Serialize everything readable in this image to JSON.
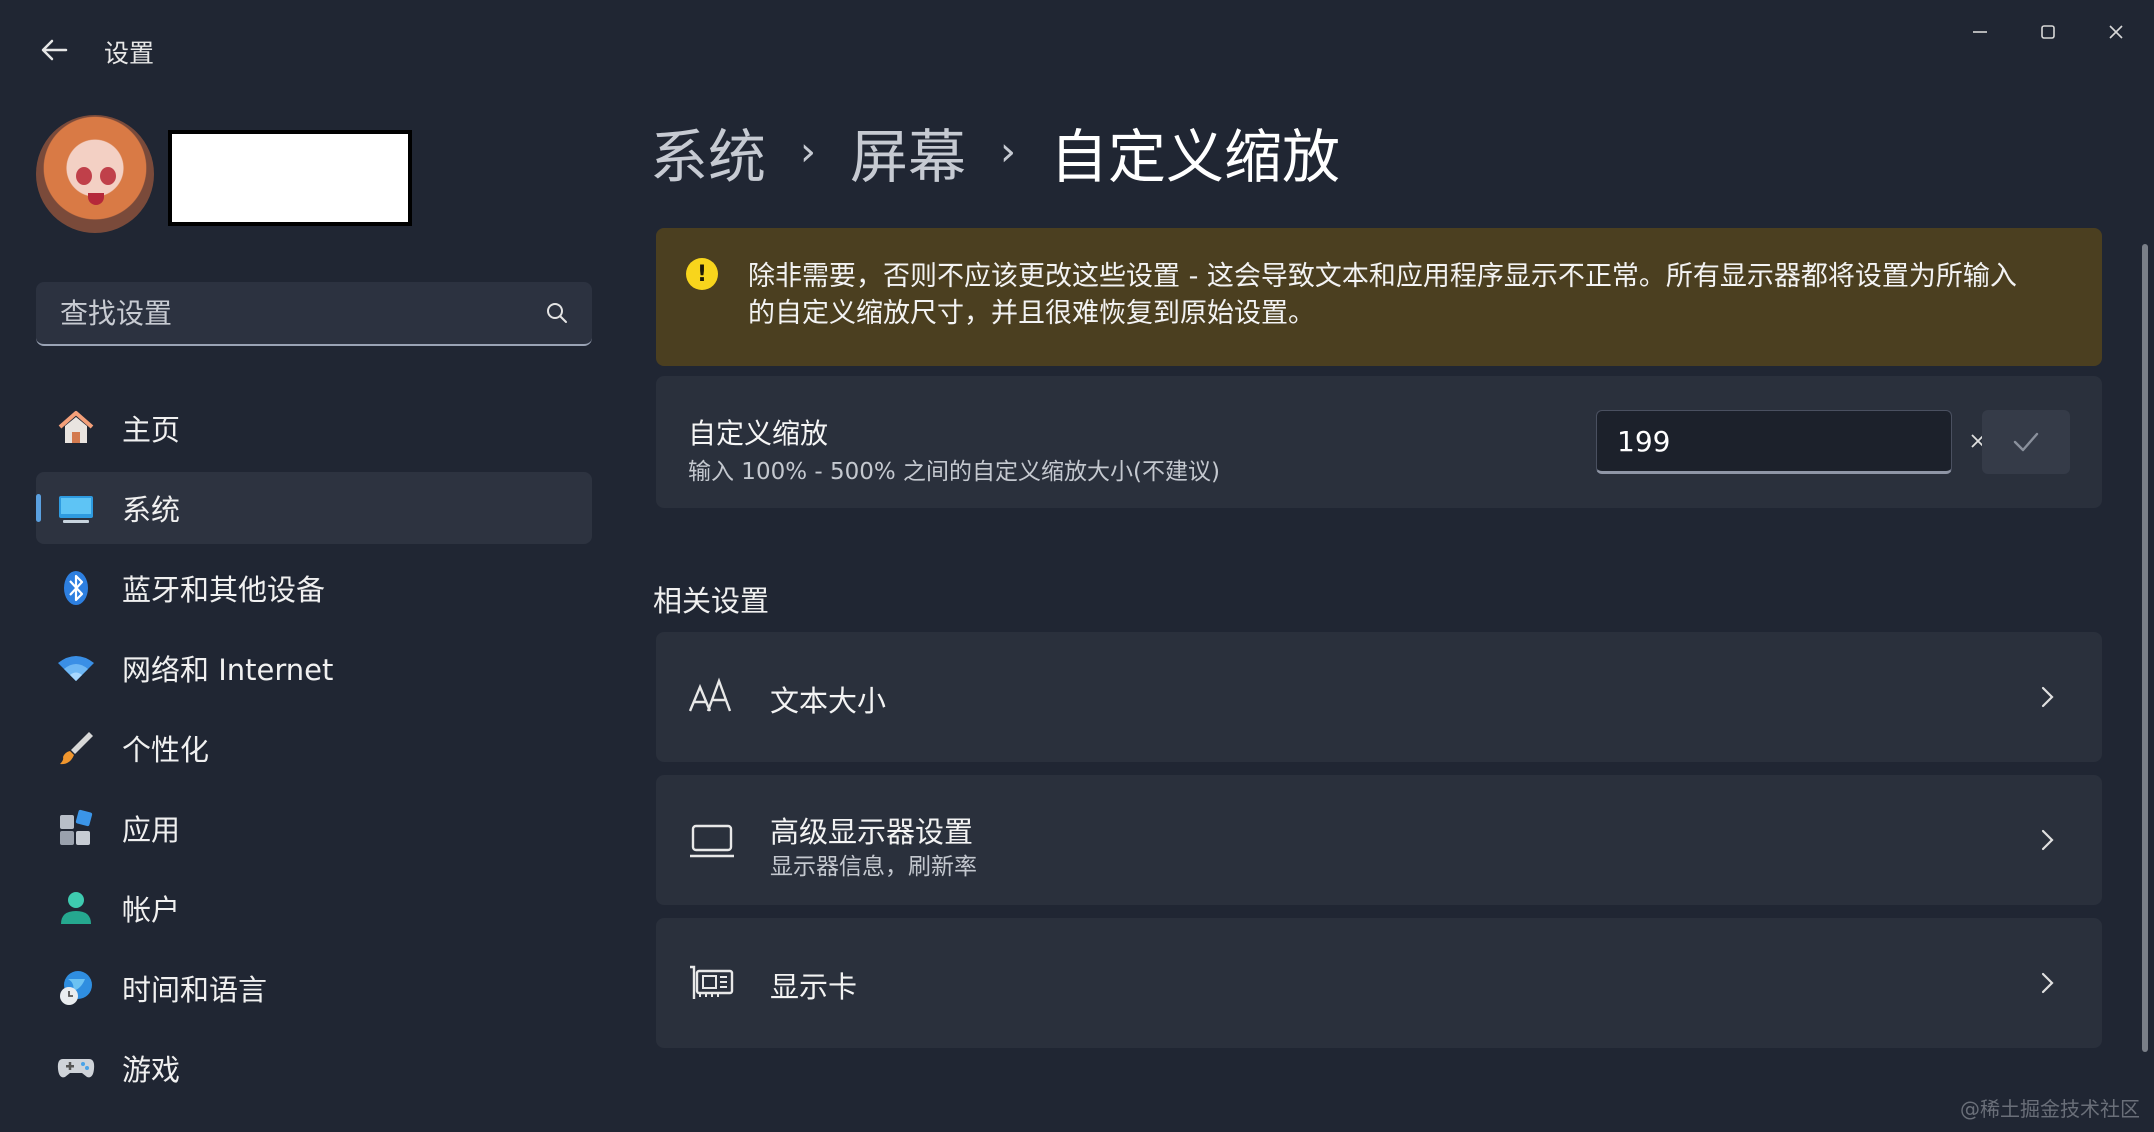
{
  "app": {
    "title": "设置",
    "window_controls": {
      "minimize": "minimize-icon",
      "maximize": "maximize-icon",
      "close": "close-icon"
    }
  },
  "search": {
    "placeholder": "查找设置"
  },
  "nav": {
    "items": [
      {
        "label": "主页",
        "icon": "home-icon"
      },
      {
        "label": "系统",
        "icon": "system-display-icon",
        "active": true
      },
      {
        "label": "蓝牙和其他设备",
        "icon": "bluetooth-icon"
      },
      {
        "label": "网络和 Internet",
        "icon": "wifi-icon"
      },
      {
        "label": "个性化",
        "icon": "paintbrush-icon"
      },
      {
        "label": "应用",
        "icon": "apps-icon"
      },
      {
        "label": "帐户",
        "icon": "account-icon"
      },
      {
        "label": "时间和语言",
        "icon": "globe-clock-icon"
      },
      {
        "label": "游戏",
        "icon": "gamepad-icon"
      }
    ]
  },
  "breadcrumb": {
    "items": [
      "系统",
      "屏幕",
      "自定义缩放"
    ],
    "separator": "›"
  },
  "warning": {
    "icon": "exclamation-icon",
    "line1": "除非需要，否则不应该更改这些设置 - 这会导致文本和应用程序显示不正常。所有显示器都将设置为所输入",
    "line2": "的自定义缩放尺寸，并且很难恢复到原始设置。"
  },
  "custom_scaling": {
    "title": "自定义缩放",
    "description": "输入 100% - 500% 之间的自定义缩放大小(不建议)",
    "input_value": "199"
  },
  "related": {
    "title": "相关设置",
    "items": [
      {
        "title": "文本大小",
        "subtitle": "",
        "icon": "text-size-icon"
      },
      {
        "title": "高级显示器设置",
        "subtitle": "显示器信息，刷新率",
        "icon": "monitor-icon"
      },
      {
        "title": "显示卡",
        "subtitle": "",
        "icon": "graphics-card-icon"
      }
    ]
  },
  "watermark": "@稀土掘金技术社区",
  "colors": {
    "background": "#202633",
    "card": "#2a303c",
    "warning_bg": "#4b3f20",
    "warning_icon": "#f8d51c",
    "accent": "#5aa0e0"
  }
}
